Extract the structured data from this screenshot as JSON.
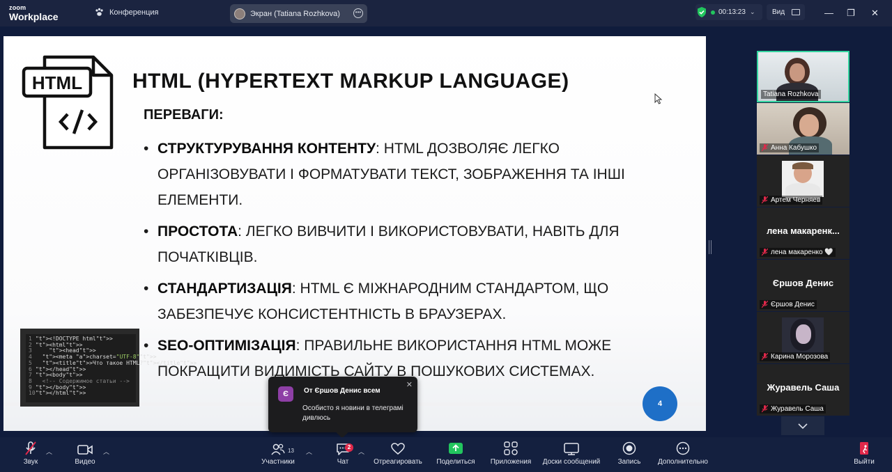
{
  "app": {
    "brand_small": "zoom",
    "brand_large": "Workplace"
  },
  "topbar": {
    "meeting_label": "Конференция",
    "screen_share_label": "Экран (Tatiana Rozhkova)",
    "timer": "00:13:23",
    "view_label": "Вид",
    "secure_color": "#22c55e"
  },
  "slide": {
    "title": "HTML (HYPERTEXT MARKUP LANGUAGE)",
    "icon_text": "HTML",
    "subtitle": "ПЕРЕВАГИ:",
    "bullets": [
      {
        "term": "СТРУКТУРУВАННЯ КОНТЕНТУ",
        "text": ": HTML ДОЗВОЛЯЄ ЛЕГКО ОРГАНІЗОВУВАТИ І ФОРМАТУВАТИ ТЕКСТ, ЗОБРАЖЕННЯ ТА ІНШІ ЕЛЕМЕНТИ."
      },
      {
        "term": "ПРОСТОТА",
        "text": ": ЛЕГКО ВИВЧИТИ І ВИКОРИСТОВУВАТИ, НАВІТЬ ДЛЯ ПОЧАТКІВЦІВ."
      },
      {
        "term": "СТАНДАРТИЗАЦІЯ",
        "text": ": HTML Є МІЖНАРОДНИМ СТАНДАРТОМ, ЩО ЗАБЕЗПЕЧУЄ КОНСИСТЕНТНІСТЬ В БРАУЗЕРАХ."
      },
      {
        "term": "SEO-ОПТИМІЗАЦІЯ",
        "text": ": ПРАВИЛЬНЕ ВИКОРИСТАННЯ HTML МОЖЕ ПОКРАЩИТИ ВИДИМІСТЬ САЙТУ В ПОШУКОВИХ СИСТЕМАХ."
      }
    ],
    "page_number": "4",
    "code_lines": [
      {
        "n": "1",
        "code": "<!DOCTYPE html>"
      },
      {
        "n": "2",
        "code": "<html>"
      },
      {
        "n": "3",
        "code": "    <head>"
      },
      {
        "n": "4",
        "code": "  <meta charset=\"UTF-8\">"
      },
      {
        "n": "5",
        "code": "  <title>Что такое HTML?</title>"
      },
      {
        "n": "6",
        "code": "</head>"
      },
      {
        "n": "7",
        "code": "<body>"
      },
      {
        "n": "8",
        "code": "  <!-- Содержимое статьи -->"
      },
      {
        "n": "9",
        "code": "</body>"
      },
      {
        "n": "10",
        "code": "</html>"
      }
    ]
  },
  "participants": [
    {
      "name": "Tatiana Rozhkova",
      "muted": false,
      "has_video": true
    },
    {
      "name": "Анна Кабушко",
      "muted": true,
      "has_video": true
    },
    {
      "name": "Артем Черняев",
      "muted": true,
      "has_video": true
    },
    {
      "display": "лена макаренк...",
      "name": "лена макаренко 🤍",
      "muted": true,
      "has_video": false
    },
    {
      "display": "Єршов Денис",
      "name": "Єршов Денис",
      "muted": true,
      "has_video": false
    },
    {
      "name": "Карина Морозова",
      "muted": true,
      "has_video": true
    },
    {
      "display": "Журавель Саша",
      "name": "Журавель Саша",
      "muted": true,
      "has_video": false
    }
  ],
  "chat_toast": {
    "avatar_letter": "Є",
    "from": "От Єршов Денис всем",
    "message": "Особисто я новини в телеграмі дивлюсь",
    "close": "✕"
  },
  "toolbar": {
    "audio": "Звук",
    "video": "Видео",
    "participants": "Участники",
    "participants_count": "13",
    "chat": "Чат",
    "chat_badge": "2",
    "react": "Отреагировать",
    "share": "Поделиться",
    "apps": "Приложения",
    "whiteboards": "Доски сообщений",
    "record": "Запись",
    "more": "Дополнительно",
    "leave": "Выйти",
    "share_color": "#22c55e",
    "leave_color": "#e0284a"
  }
}
